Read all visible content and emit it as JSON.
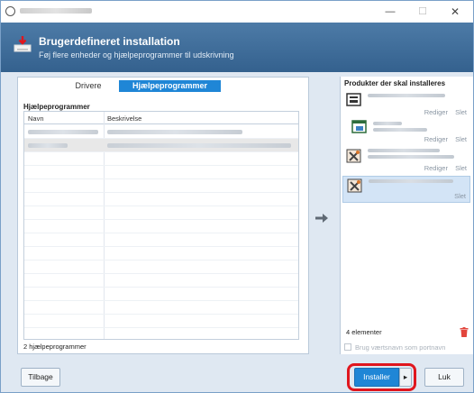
{
  "window": {
    "controls": {
      "minimize": "—",
      "maximize": "☐",
      "close": "✕"
    }
  },
  "header": {
    "title": "Brugerdefineret installation",
    "subtitle": "Føj flere enheder og hjælpeprogrammer til udskrivning",
    "background_color": "#3f6d9a"
  },
  "tabs": [
    {
      "label": "Drivere",
      "active": false
    },
    {
      "label": "Hjælpeprogrammer",
      "active": true
    }
  ],
  "utilities": {
    "section_label": "Hjælpeprogrammer",
    "columns": [
      "Navn",
      "Beskrivelse"
    ],
    "rows_count": 2,
    "selected_row": 1,
    "footer": "2 hjælpeprogrammer"
  },
  "arrow_icon": "right-arrow-icon",
  "products": {
    "title": "Produkter der skal installeres",
    "items": [
      {
        "icon": "printer-driver-icon",
        "actions": [
          "Rediger",
          "Slet"
        ],
        "selected": false
      },
      {
        "icon": "window-app-icon",
        "actions": [
          "Rediger",
          "Slet"
        ],
        "selected": false
      },
      {
        "icon": "tools-icon",
        "actions": [
          "Rediger",
          "Slet"
        ],
        "selected": false
      },
      {
        "icon": "tools-icon",
        "actions": [
          "Slet"
        ],
        "selected": true
      }
    ],
    "count": "4 elementer",
    "hostname_checkbox": "Brug værtsnavn som portnavn"
  },
  "buttons": {
    "back": "Tilbage",
    "install": "Installer",
    "install_dropdown": "▸",
    "close": "Luk"
  },
  "colors": {
    "accent": "#1f86d6",
    "highlight": "#e0161e",
    "trash": "#e2453c"
  }
}
